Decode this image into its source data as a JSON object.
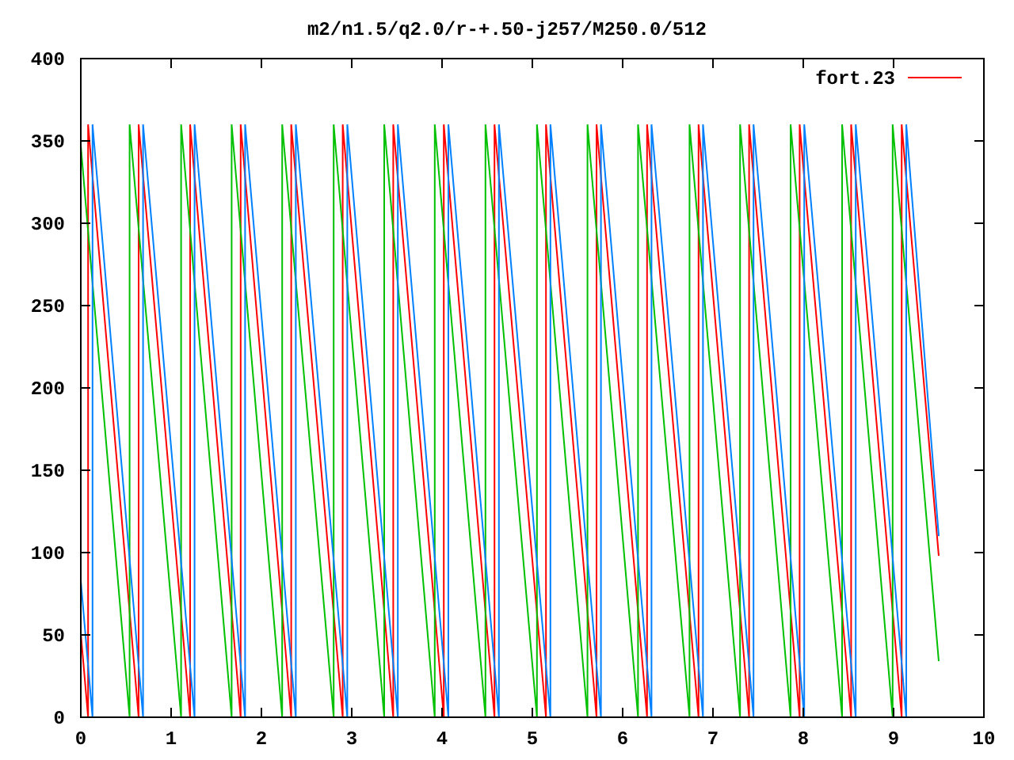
{
  "plot": {
    "chart_data": {
      "type": "line",
      "title": "m2/n1.5/q2.0/r-+.50-j257/M250.0/512",
      "xlim": [
        0,
        10
      ],
      "ylim": [
        0,
        400
      ],
      "xticks": [
        0,
        1,
        2,
        3,
        4,
        5,
        6,
        7,
        8,
        9,
        10
      ],
      "yticks": [
        0,
        50,
        100,
        150,
        200,
        250,
        300,
        350,
        400
      ],
      "series": [
        {
          "name": "fort.23",
          "color": "#ff0000",
          "x": [
            0,
            0.08,
            0.08,
            0.64,
            0.64,
            1.21,
            1.21,
            1.77,
            1.77,
            2.33,
            2.33,
            2.9,
            2.9,
            3.46,
            3.46,
            4.02,
            4.02,
            4.58,
            4.58,
            5.15,
            5.15,
            5.71,
            5.71,
            6.27,
            6.27,
            6.84,
            6.84,
            7.4,
            7.4,
            7.96,
            7.96,
            8.53,
            8.53,
            9.09,
            9.09,
            9.5
          ],
          "values": [
            51,
            0,
            360,
            0,
            360,
            0,
            360,
            0,
            360,
            0,
            360,
            0,
            360,
            0,
            360,
            0,
            360,
            0,
            360,
            0,
            360,
            0,
            360,
            0,
            360,
            0,
            360,
            0,
            360,
            0,
            360,
            0,
            360,
            0,
            360,
            98
          ]
        },
        {
          "color": "#00c000",
          "x": [
            0,
            0.54,
            0.54,
            1.11,
            1.11,
            1.67,
            1.67,
            2.23,
            2.23,
            2.8,
            2.8,
            3.36,
            3.36,
            3.92,
            3.92,
            4.48,
            4.48,
            5.05,
            5.05,
            5.61,
            5.61,
            6.17,
            6.17,
            6.74,
            6.74,
            7.3,
            7.3,
            7.86,
            7.86,
            8.43,
            8.43,
            8.99,
            8.99,
            9.5
          ],
          "values": [
            347,
            0,
            360,
            0,
            360,
            0,
            360,
            0,
            360,
            0,
            360,
            0,
            360,
            0,
            360,
            0,
            360,
            0,
            360,
            0,
            360,
            0,
            360,
            0,
            360,
            0,
            360,
            0,
            360,
            0,
            360,
            0,
            360,
            34
          ]
        },
        {
          "color": "#0080ff",
          "x": [
            0,
            0.13,
            0.13,
            0.69,
            0.69,
            1.26,
            1.26,
            1.82,
            1.82,
            2.38,
            2.38,
            2.95,
            2.95,
            3.51,
            3.51,
            4.07,
            4.07,
            4.63,
            4.63,
            5.2,
            5.2,
            5.76,
            5.76,
            6.32,
            6.32,
            6.89,
            6.89,
            7.45,
            7.45,
            8.01,
            8.01,
            8.58,
            8.58,
            9.14,
            9.14,
            9.5
          ],
          "values": [
            83,
            0,
            360,
            0,
            360,
            0,
            360,
            0,
            360,
            0,
            360,
            0,
            360,
            0,
            360,
            0,
            360,
            0,
            360,
            0,
            360,
            0,
            360,
            0,
            360,
            0,
            360,
            0,
            360,
            0,
            360,
            0,
            360,
            0,
            360,
            110
          ]
        }
      ]
    }
  }
}
